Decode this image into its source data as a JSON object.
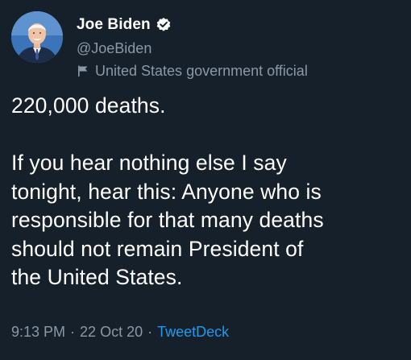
{
  "author": {
    "display_name": "Joe Biden",
    "handle": "@JoeBiden",
    "label": "United States government official",
    "verified_icon": "verified-badge-icon",
    "label_icon": "flag-icon"
  },
  "tweet": {
    "line1": "220,000 deaths.",
    "line2": "If you hear nothing else I say\ntonight, hear this: Anyone who is\nresponsible for that many deaths\nshould not remain President of\nthe United States."
  },
  "meta": {
    "time": "9:13 PM",
    "separator1": "·",
    "date": "22 Oct 20",
    "separator2": "·",
    "source": "TweetDeck"
  },
  "colors": {
    "background": "#15202b",
    "secondary_text": "#8b98a5",
    "link": "#1d9bf0"
  }
}
